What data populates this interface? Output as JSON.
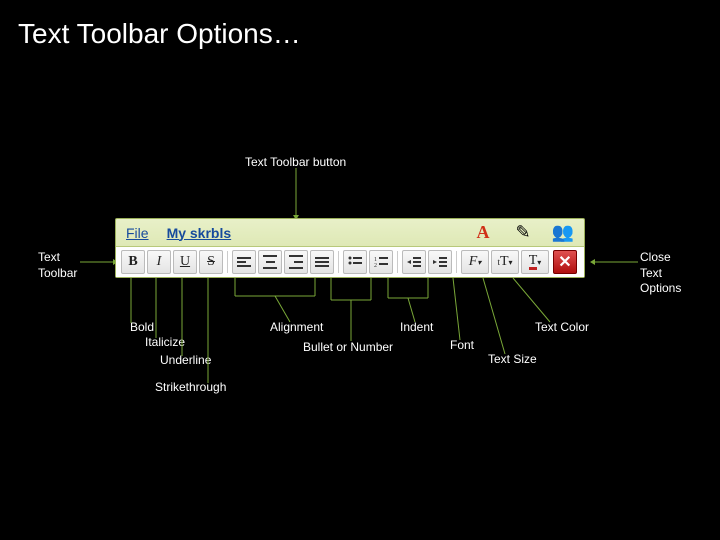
{
  "title": "Text Toolbar Options…",
  "callouts": {
    "top": "Text Toolbar button",
    "left": "Text\nToolbar",
    "right": "Close\nText\nOptions",
    "bold": "Bold",
    "italic": "Italicize",
    "underline": "Underline",
    "strike": "Strikethrough",
    "align": "Alignment",
    "bullet": "Bullet or Number",
    "indent": "Indent",
    "font": "Font",
    "size": "Text Size",
    "color": "Text Color"
  },
  "menu": {
    "file": "File",
    "name": "My skrbls"
  },
  "buttons": {
    "bold": "B",
    "italic": "I",
    "underline": "U",
    "strike": "S",
    "font": "F",
    "size": "tT",
    "color": "T",
    "close": "✕"
  },
  "colors": {
    "accent": "#7aa838",
    "link": "#164a9c"
  }
}
